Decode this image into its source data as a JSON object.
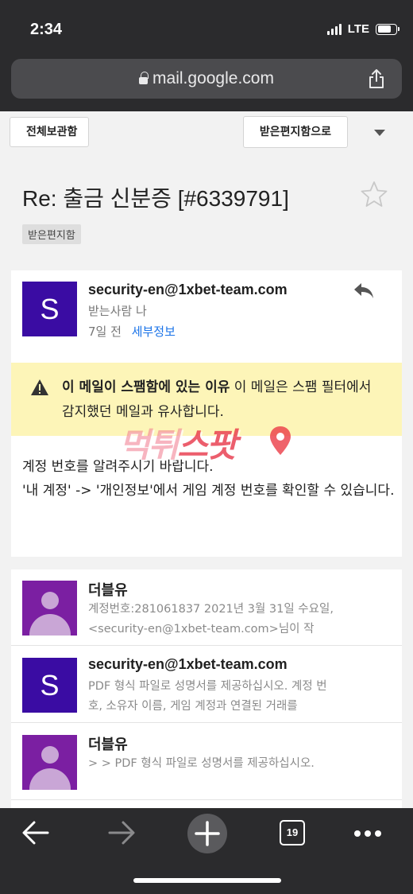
{
  "status_bar": {
    "time": "2:34",
    "network": "LTE"
  },
  "browser": {
    "url": "mail.google.com"
  },
  "toolbar": {
    "archive_label": "전체보관함",
    "move_inbox_label": "받은편지함으로"
  },
  "email": {
    "subject": "Re: 출금 신분증 [#6339791]",
    "label": "받은편지함",
    "sender": "security-en@1xbet-team.com",
    "sender_initial": "S",
    "recipient": "받는사람 나",
    "time": "7일 전",
    "details_link": "세부정보",
    "spam_title": "이 메일이 스팸함에 있는 이유",
    "spam_text": " 이 메일은 스팸 필터에서 감지했던 메일과 유사합니다.",
    "body_line1": "계정 번호를 알려주시기 바랍니다.",
    "body_line2": "'내 계정' -> '개인정보'에서 게임 계정 번호를 확인할 수 있습니다."
  },
  "watermark": {
    "text_a": "먹튀",
    "text_b": "스팟"
  },
  "thread": [
    {
      "name": "더블유",
      "snippet": "계정번호:281061837 2021년 3월 31일 수요일, <security-en@1xbet-team.com>님이 작"
    },
    {
      "name": "security-en@1xbet-team.com",
      "initial": "S",
      "snippet": "PDF 형식 파일로 성명서를 제공하십시오. 계정 번호, 소유자 이름, 게임 계정과 연결된 거래를"
    },
    {
      "name": "더블유",
      "snippet": "> > PDF 형식 파일로 성명서를 제공하십시오."
    }
  ],
  "bottom_bar": {
    "tab_count": "19"
  },
  "colors": {
    "avatar_s": "#3a0ca3",
    "avatar_person": "#7b1fa2",
    "spam_bg": "#fdf5b8",
    "link": "#1a73e8"
  },
  "icons": [
    "lock-icon",
    "share-icon",
    "star-icon",
    "reply-icon",
    "warning-icon",
    "back-arrow-icon",
    "forward-arrow-icon",
    "plus-icon",
    "tabs-icon",
    "more-icon"
  ]
}
